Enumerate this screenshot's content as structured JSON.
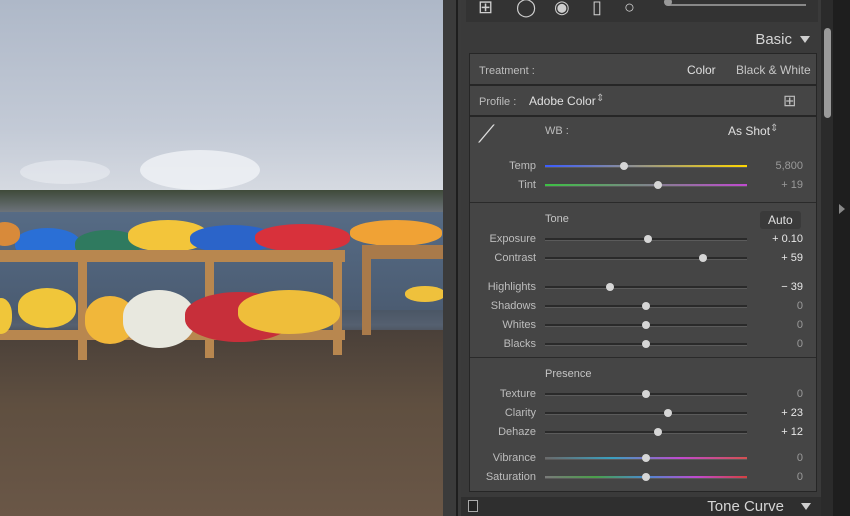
{
  "header": {
    "title": "Basic",
    "footer_title": "Tone Curve"
  },
  "treatment": {
    "label": "Treatment :",
    "color": "Color",
    "bw": "Black & White"
  },
  "profile": {
    "label": "Profile :",
    "value": "Adobe Color"
  },
  "wb": {
    "label": "WB :",
    "value": "As Shot"
  },
  "sliders_wb": [
    {
      "label": "Temp",
      "value": "5,800",
      "pos": 0.39
    },
    {
      "label": "Tint",
      "value": "+ 19",
      "pos": 0.56
    }
  ],
  "tone": {
    "title": "Tone",
    "auto": "Auto"
  },
  "sliders_tone": [
    {
      "label": "Exposure",
      "value": "+ 0.10",
      "pos": 0.51
    },
    {
      "label": "Contrast",
      "value": "+ 59",
      "pos": 0.78
    },
    {
      "label": "Highlights",
      "value": "− 39",
      "pos": 0.32
    },
    {
      "label": "Shadows",
      "value": "0",
      "pos": 0.5
    },
    {
      "label": "Whites",
      "value": "0",
      "pos": 0.5
    },
    {
      "label": "Blacks",
      "value": "0",
      "pos": 0.5
    }
  ],
  "presence": {
    "title": "Presence"
  },
  "sliders_presence": [
    {
      "label": "Texture",
      "value": "0",
      "pos": 0.5
    },
    {
      "label": "Clarity",
      "value": "+ 23",
      "pos": 0.61
    },
    {
      "label": "Dehaze",
      "value": "+ 12",
      "pos": 0.56
    },
    {
      "label": "Vibrance",
      "value": "0",
      "pos": 0.5
    },
    {
      "label": "Saturation",
      "value": "0",
      "pos": 0.5
    }
  ],
  "colors": {
    "temp": "#ffd700",
    "tint": "#c04ad0"
  }
}
